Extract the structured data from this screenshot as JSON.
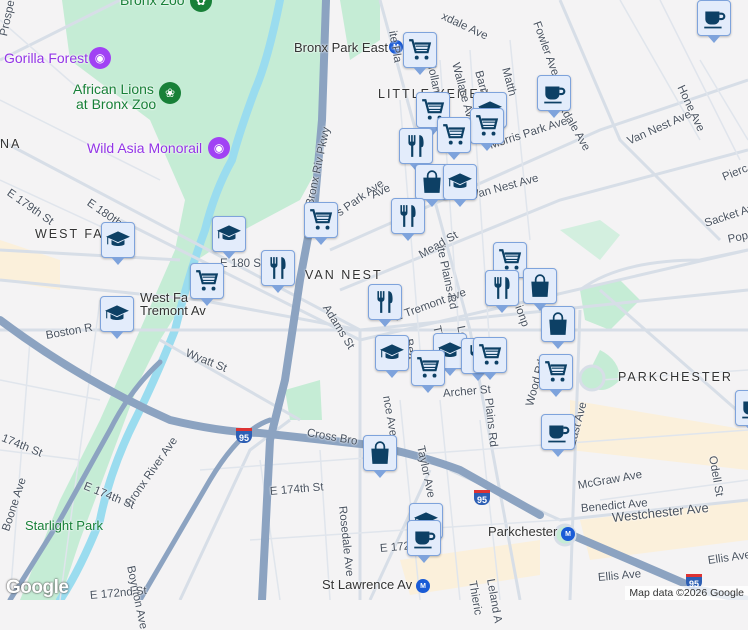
{
  "map": {
    "neighborhoods": {
      "west_farms": "WEST FA",
      "van_nest": "VAN NEST",
      "little_yemen": "LITTLE YEMEN",
      "parkchester": "PARKCHESTER",
      "na": "NA"
    },
    "pois": {
      "bronx_zoo": "Bronx Zoo",
      "gorilla_forest": "Gorilla Forest",
      "african_lions": "African Lions",
      "african_lions_2": "at Bronx Zoo",
      "wild_asia": "Wild Asia Monorail",
      "starlight_park": "Starlight Park"
    },
    "stations": {
      "bronx_park_east": "Bronx Park East",
      "west_farms_sq": "West Fa",
      "west_farms_sq_2": "Tremont Av",
      "parkchester": "Parkchester",
      "st_lawrence": "St Lawrence Av"
    },
    "streets": {
      "prospect": "Prospect",
      "bronx_riv_pkwy": "Bronx Riv Pkwy",
      "e180": "E 180th St",
      "e180b": "E 180 S",
      "e179": "E 179th St",
      "boston": "Boston R",
      "wyatt": "Wyatt St",
      "cross_bronx": "Cross Bro",
      "bronx_river_ave": "Bronx River Ave",
      "e174a": "174th St",
      "e174b": "E 174th St",
      "e174c": "E 174th St",
      "boone": "Boone Ave",
      "boynton": "Boynton Ave",
      "e172": "E 172nd St",
      "rosedale": "Rosedale Ave",
      "adams": "Adams St",
      "e_tremont": "E Tremont Ave",
      "morris_park_w": "s Park Ave",
      "morris_park": "Morris Park Ave",
      "van_nest_ave": "Van Nest Ave",
      "van_nest_ave2": "Van Nest Ave",
      "mead": "Mead St",
      "white_plains": "ite Plains Rd",
      "white_plains2": "Plains Rd",
      "white_plains3": "ite Pla",
      "bronxdale": "Bronxdale Ave",
      "bronxdale2": "xdale Ave",
      "holland": "Holland Ave",
      "wallace": "Wallace Ave",
      "barnes": "Barnes Ave",
      "matthews": "Matth",
      "fowler": "Fowler Ave",
      "hone": "Hone Ave",
      "sacket": "Sacket Av",
      "poplar": "Pop",
      "archer": "Archer St",
      "taylor": "Taylor Ave",
      "leland": "Leland",
      "leland2": "Leland A",
      "thieriot": "Thie",
      "thieriot2": "Thieric",
      "beach": "Bea",
      "noble": "nce Ave",
      "unionport": "ionp",
      "wood": "Wood Rd",
      "east_ave": "East Ave",
      "mcgraw": "McGraw Ave",
      "benedict": "Benedict Ave",
      "westchester": "Westchester Ave",
      "ellis": "Ellis Ave",
      "ellis2": "Ellis Ave",
      "odell": "Odell St",
      "e172b": "E 172",
      "pierce": "Pierc",
      "van_nest_w": "Ave"
    },
    "highway_shields": [
      "95",
      "95",
      "95"
    ],
    "markers": [
      {
        "type": "cafe"
      },
      {
        "type": "cart"
      },
      {
        "type": "cafe"
      },
      {
        "type": "school"
      },
      {
        "type": "cart"
      },
      {
        "type": "cart"
      },
      {
        "type": "cart"
      },
      {
        "type": "restaurant"
      },
      {
        "type": "shopping"
      },
      {
        "type": "school"
      },
      {
        "type": "restaurant"
      },
      {
        "type": "cart"
      },
      {
        "type": "school"
      },
      {
        "type": "school"
      },
      {
        "type": "restaurant"
      },
      {
        "type": "cart"
      },
      {
        "type": "school"
      },
      {
        "type": "restaurant"
      },
      {
        "type": "cart"
      },
      {
        "type": "restaurant"
      },
      {
        "type": "shopping"
      },
      {
        "type": "shopping"
      },
      {
        "type": "school"
      },
      {
        "type": "school"
      },
      {
        "type": "cart"
      },
      {
        "type": "restaurant"
      },
      {
        "type": "cart"
      },
      {
        "type": "cart"
      },
      {
        "type": "cafe"
      },
      {
        "type": "cafe"
      },
      {
        "type": "shopping"
      },
      {
        "type": "school"
      },
      {
        "type": "cafe"
      }
    ],
    "logo": "Google",
    "attribution": "Map data ©2026 Google",
    "colors": {
      "park": "#c5ecd5",
      "water": "#9adcef",
      "highway": "#8ca3c1",
      "road": "#d7dee7",
      "marker_fill": "#e3ecfb",
      "marker_icon": "#0d4065",
      "background": "#f4f3f4"
    }
  }
}
